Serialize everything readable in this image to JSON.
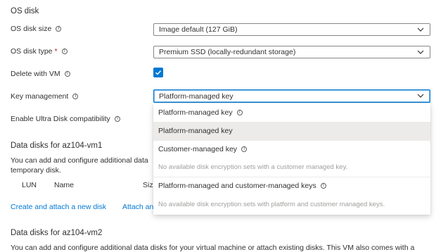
{
  "os_disk": {
    "section_title": "OS disk",
    "size": {
      "label": "OS disk size",
      "value": "Image default (127 GiB)"
    },
    "type": {
      "label": "OS disk type",
      "required_mark": "*",
      "value": "Premium SSD (locally-redundant storage)"
    },
    "delete_with_vm": {
      "label": "Delete with VM",
      "checked": true
    },
    "key_management": {
      "label": "Key management",
      "value": "Platform-managed key"
    },
    "ultra_disk": {
      "label": "Enable Ultra Disk compatibility"
    }
  },
  "key_dropdown": {
    "options": [
      {
        "label": "Platform-managed key",
        "description": ""
      },
      {
        "label": "Platform-managed key",
        "description": "",
        "selected": true
      },
      {
        "label": "Customer-managed key",
        "description": "No available disk encryption sets with a customer managed key."
      },
      {
        "label": "Platform-managed and customer-managed keys",
        "description": "No available disk encryption sets with platform and customer managed keys."
      }
    ]
  },
  "data_disks_vm1": {
    "title": "Data disks for az104-vm1",
    "description_line1": "You can add and configure additional data",
    "description_line2": "temporary disk.",
    "columns": {
      "lun": "LUN",
      "name": "Name",
      "size": "Siz"
    },
    "create_link": "Create and attach a new disk",
    "attach_link": "Attach an"
  },
  "data_disks_vm2": {
    "title": "Data disks for az104-vm2",
    "description_line1": "You can add and configure additional data disks for your virtual machine or attach existing disks. This VM also comes with a"
  },
  "colors": {
    "accent": "#0078d4",
    "text": "#323130",
    "muted": "#a19f9d"
  }
}
